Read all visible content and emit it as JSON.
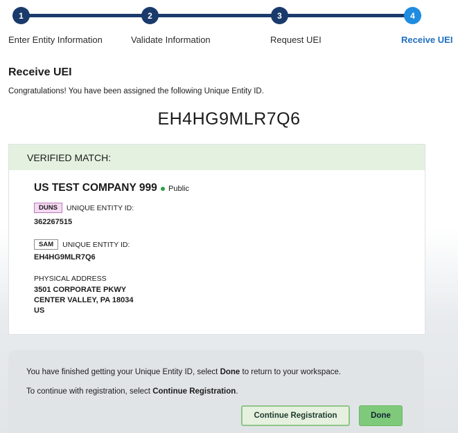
{
  "stepper": {
    "steps": [
      {
        "number": "1",
        "label": "Enter Entity Information"
      },
      {
        "number": "2",
        "label": "Validate Information"
      },
      {
        "number": "3",
        "label": "Request UEI"
      },
      {
        "number": "4",
        "label": "Receive UEI"
      }
    ],
    "active_step": 4
  },
  "page": {
    "title": "Receive UEI",
    "congrats": "Congratulations! You have been assigned the following Unique Entity ID.",
    "uei": "EH4HG9MLR7Q6"
  },
  "card": {
    "header": "VERIFIED MATCH:",
    "company": "US TEST COMPANY 999",
    "visibility": "Public",
    "duns": {
      "tag": "DUNS",
      "label": "UNIQUE ENTITY ID:",
      "value": "362267515"
    },
    "sam": {
      "tag": "SAM",
      "label": "UNIQUE ENTITY ID:",
      "value": "EH4HG9MLR7Q6"
    },
    "address": {
      "label": "PHYSICAL ADDRESS",
      "line1": "3501 CORPORATE PKWY",
      "line2": "CENTER VALLEY, PA 18034",
      "line3": "US"
    }
  },
  "panel": {
    "line1_prefix": "You have finished getting your Unique Entity ID, select ",
    "line1_bold": "Done",
    "line1_suffix": " to return to your workspace.",
    "line2_prefix": "To continue with registration, select ",
    "line2_bold": "Continue Registration",
    "line2_suffix": ".",
    "continue_button": "Continue Registration",
    "done_button": "Done"
  },
  "colors": {
    "step_complete": "#1a3a6b",
    "step_active": "#1f8ce0",
    "verified_header_bg": "#e4f1e0",
    "public_dot": "#2e9e44",
    "done_button_bg": "#7fc97a"
  }
}
